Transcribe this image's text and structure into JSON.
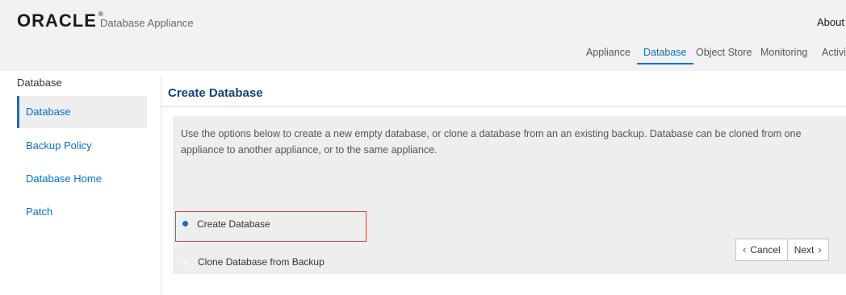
{
  "header": {
    "brand": "ORACLE",
    "product": "Database Appliance",
    "about": "About",
    "tabs": [
      {
        "label": "Appliance",
        "active": false
      },
      {
        "label": "Database",
        "active": true
      },
      {
        "label": "Object Store",
        "active": false
      },
      {
        "label": "Monitoring",
        "active": false
      },
      {
        "label": "Activit",
        "active": false
      }
    ]
  },
  "sidebar": {
    "title": "Database",
    "items": [
      {
        "label": "Database",
        "active": true
      },
      {
        "label": "Backup Policy",
        "active": false
      },
      {
        "label": "Database Home",
        "active": false
      },
      {
        "label": "Patch",
        "active": false
      }
    ]
  },
  "main": {
    "title": "Create Database",
    "description": "Use the options below to create a new empty database, or clone a database from an an existing backup. Database can be cloned from one appliance to another appliance, or to the same appliance.",
    "options": [
      {
        "label": "Create Database",
        "selected": true
      },
      {
        "label": "Clone Database from Backup",
        "selected": false
      }
    ],
    "buttons": {
      "cancel": "Cancel",
      "next": "Next"
    }
  },
  "colors": {
    "accent": "#0572ce",
    "title": "#16436e",
    "highlight": "#d94040"
  }
}
